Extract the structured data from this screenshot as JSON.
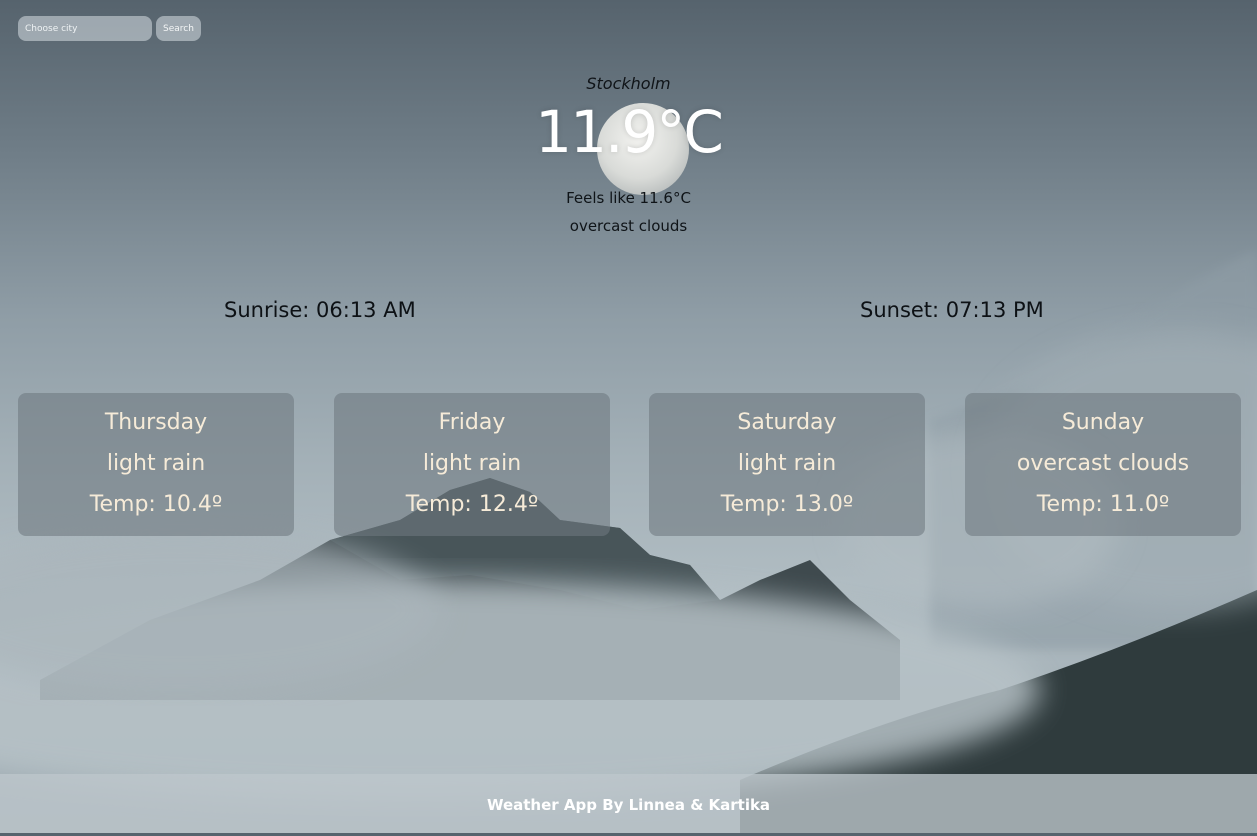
{
  "search": {
    "placeholder": "Choose city",
    "button_label": "Search"
  },
  "current": {
    "city": "Stockholm",
    "temperature": "11.9°C",
    "feels_like": "Feels like 11.6°C",
    "description": "overcast clouds",
    "icon": "moon-icon"
  },
  "sun": {
    "sunrise": "Sunrise: 06:13 AM",
    "sunset": "Sunset: 07:13 PM"
  },
  "forecast": [
    {
      "day": "Thursday",
      "description": "light rain",
      "temp": "Temp: 10.4º"
    },
    {
      "day": "Friday",
      "description": "light rain",
      "temp": "Temp: 12.4º"
    },
    {
      "day": "Saturday",
      "description": "light rain",
      "temp": "Temp: 13.0º"
    },
    {
      "day": "Sunday",
      "description": "overcast clouds",
      "temp": "Temp: 11.0º"
    }
  ],
  "footer": {
    "text": "Weather App By Linnea & Kartika"
  },
  "colors": {
    "card_text": "#f6ebd8",
    "card_bg": "#6e7880",
    "footer_bg": "#bec6cc"
  }
}
